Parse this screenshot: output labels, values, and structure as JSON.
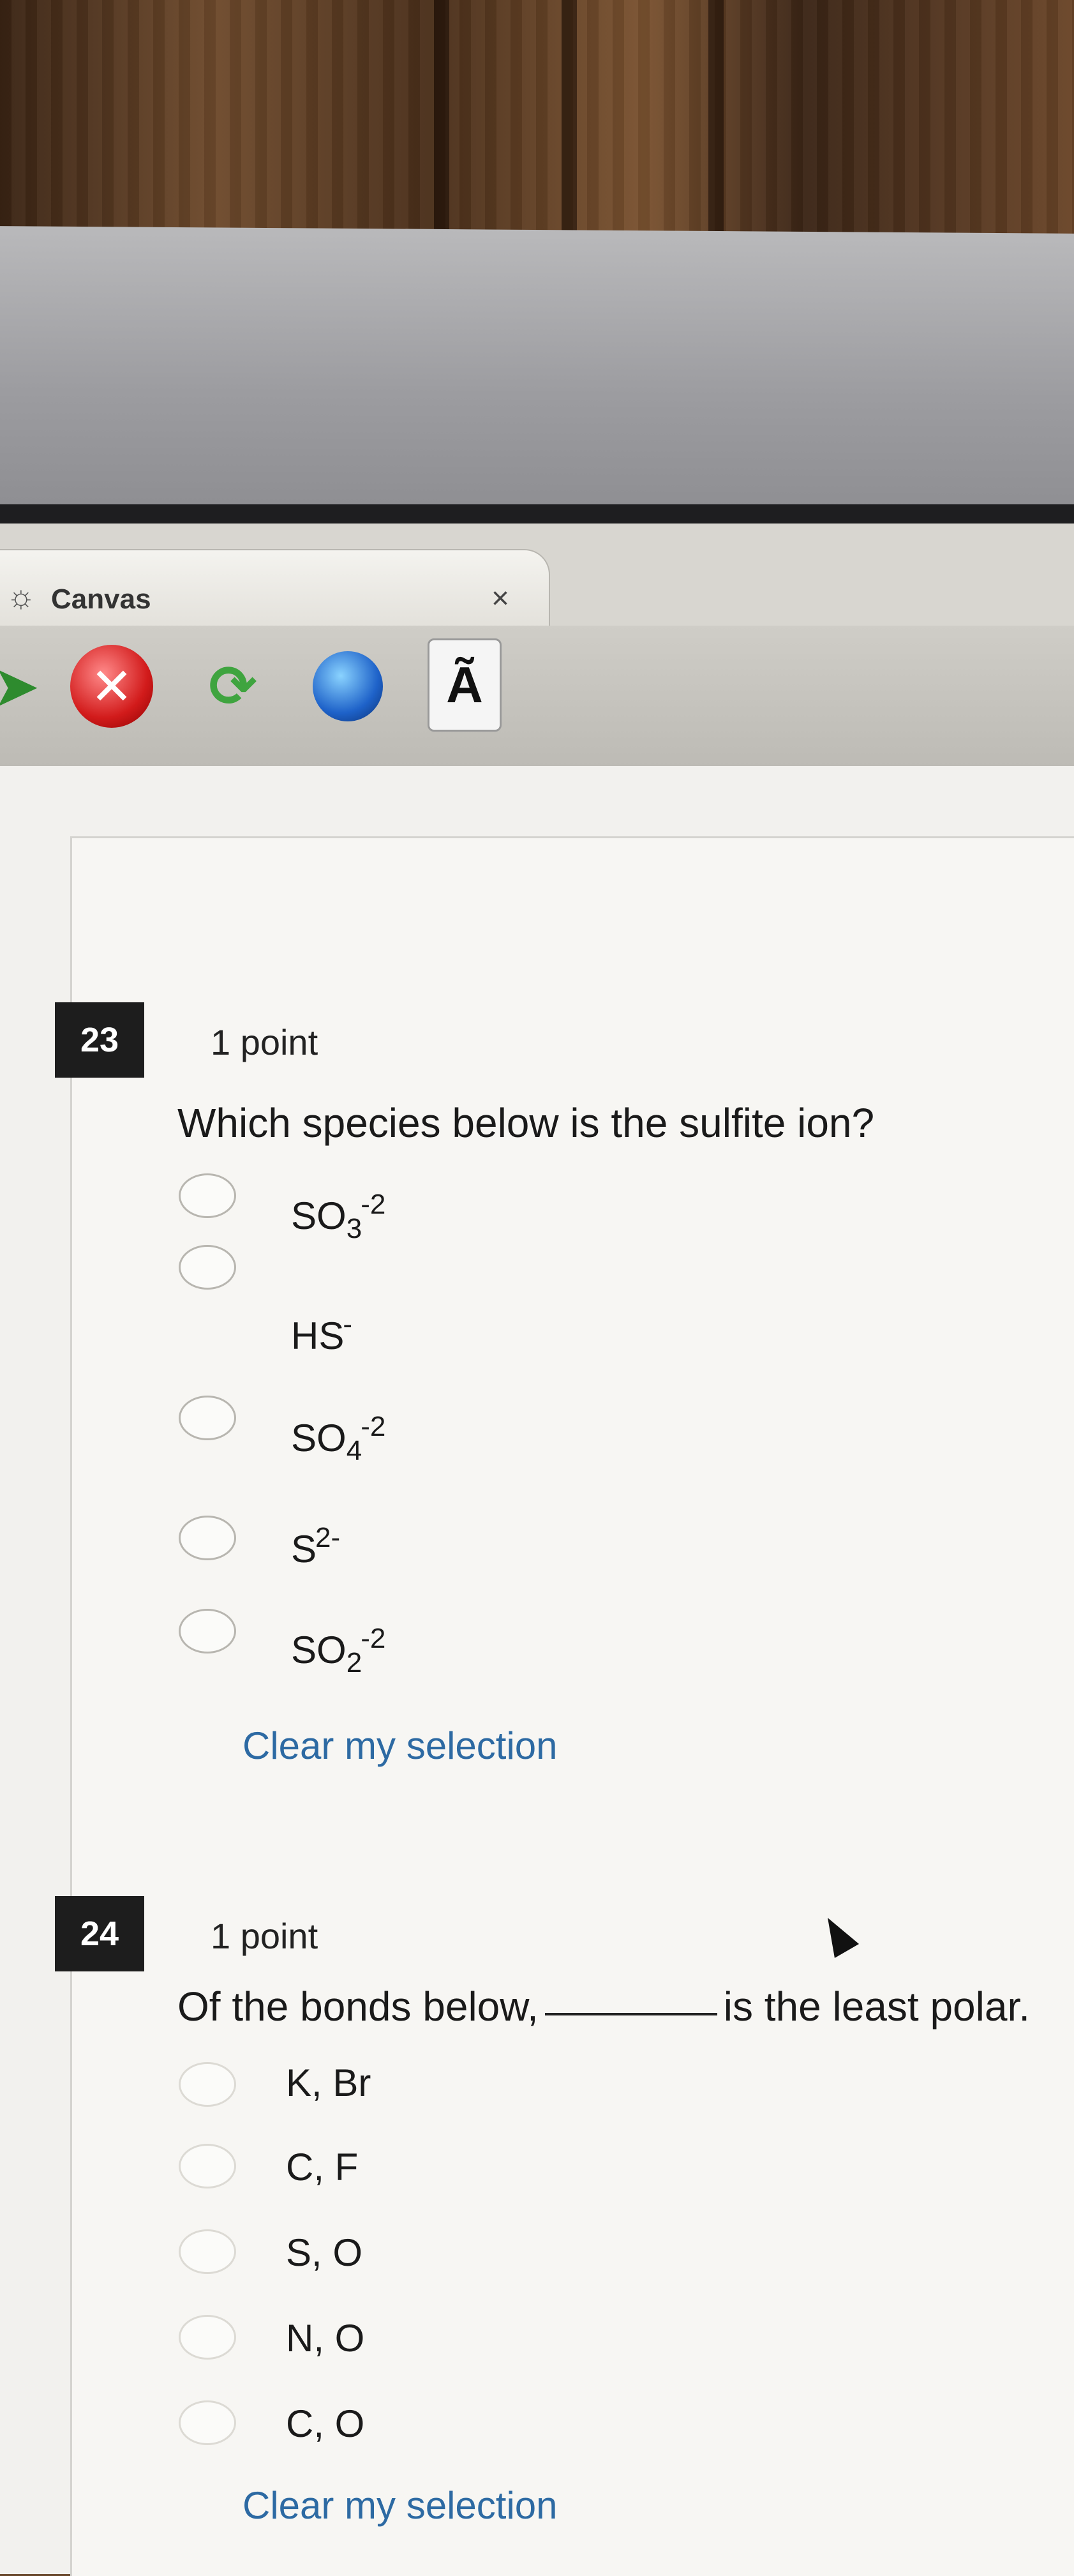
{
  "browser": {
    "tab_title": "Canvas",
    "tab_close": "×",
    "font_button": "Ã"
  },
  "questions": [
    {
      "number": "23",
      "points": "1 point",
      "text": "Which species below is the sulfite ion?",
      "options": [
        {
          "base": "SO",
          "sub": "3",
          "sup": "-2"
        },
        {
          "base": "HS",
          "sub": "",
          "sup": "-"
        },
        {
          "base": "SO",
          "sub": "4",
          "sup": "-2"
        },
        {
          "base": "S",
          "sub": "",
          "sup": "2-"
        },
        {
          "base": "SO",
          "sub": "2",
          "sup": "-2"
        }
      ],
      "clear": "Clear my selection"
    },
    {
      "number": "24",
      "points": "1 point",
      "text_before": "Of the bonds below,",
      "text_after": "is the least polar.",
      "options": [
        {
          "base": "K, Br"
        },
        {
          "base": "C, F"
        },
        {
          "base": "S, O"
        },
        {
          "base": "N, O"
        },
        {
          "base": "C, O"
        }
      ],
      "clear": "Clear my selection"
    }
  ]
}
